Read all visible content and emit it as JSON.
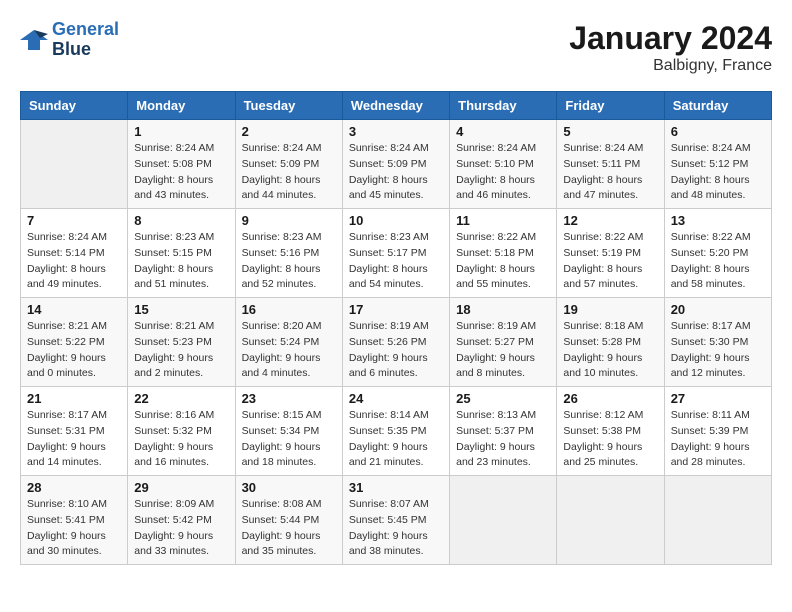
{
  "header": {
    "logo_line1": "General",
    "logo_line2": "Blue",
    "month": "January 2024",
    "location": "Balbigny, France"
  },
  "columns": [
    "Sunday",
    "Monday",
    "Tuesday",
    "Wednesday",
    "Thursday",
    "Friday",
    "Saturday"
  ],
  "weeks": [
    [
      {
        "day": "",
        "sunrise": "",
        "sunset": "",
        "daylight": ""
      },
      {
        "day": "1",
        "sunrise": "Sunrise: 8:24 AM",
        "sunset": "Sunset: 5:08 PM",
        "daylight": "Daylight: 8 hours and 43 minutes."
      },
      {
        "day": "2",
        "sunrise": "Sunrise: 8:24 AM",
        "sunset": "Sunset: 5:09 PM",
        "daylight": "Daylight: 8 hours and 44 minutes."
      },
      {
        "day": "3",
        "sunrise": "Sunrise: 8:24 AM",
        "sunset": "Sunset: 5:09 PM",
        "daylight": "Daylight: 8 hours and 45 minutes."
      },
      {
        "day": "4",
        "sunrise": "Sunrise: 8:24 AM",
        "sunset": "Sunset: 5:10 PM",
        "daylight": "Daylight: 8 hours and 46 minutes."
      },
      {
        "day": "5",
        "sunrise": "Sunrise: 8:24 AM",
        "sunset": "Sunset: 5:11 PM",
        "daylight": "Daylight: 8 hours and 47 minutes."
      },
      {
        "day": "6",
        "sunrise": "Sunrise: 8:24 AM",
        "sunset": "Sunset: 5:12 PM",
        "daylight": "Daylight: 8 hours and 48 minutes."
      }
    ],
    [
      {
        "day": "7",
        "sunrise": "Sunrise: 8:24 AM",
        "sunset": "Sunset: 5:14 PM",
        "daylight": "Daylight: 8 hours and 49 minutes."
      },
      {
        "day": "8",
        "sunrise": "Sunrise: 8:23 AM",
        "sunset": "Sunset: 5:15 PM",
        "daylight": "Daylight: 8 hours and 51 minutes."
      },
      {
        "day": "9",
        "sunrise": "Sunrise: 8:23 AM",
        "sunset": "Sunset: 5:16 PM",
        "daylight": "Daylight: 8 hours and 52 minutes."
      },
      {
        "day": "10",
        "sunrise": "Sunrise: 8:23 AM",
        "sunset": "Sunset: 5:17 PM",
        "daylight": "Daylight: 8 hours and 54 minutes."
      },
      {
        "day": "11",
        "sunrise": "Sunrise: 8:22 AM",
        "sunset": "Sunset: 5:18 PM",
        "daylight": "Daylight: 8 hours and 55 minutes."
      },
      {
        "day": "12",
        "sunrise": "Sunrise: 8:22 AM",
        "sunset": "Sunset: 5:19 PM",
        "daylight": "Daylight: 8 hours and 57 minutes."
      },
      {
        "day": "13",
        "sunrise": "Sunrise: 8:22 AM",
        "sunset": "Sunset: 5:20 PM",
        "daylight": "Daylight: 8 hours and 58 minutes."
      }
    ],
    [
      {
        "day": "14",
        "sunrise": "Sunrise: 8:21 AM",
        "sunset": "Sunset: 5:22 PM",
        "daylight": "Daylight: 9 hours and 0 minutes."
      },
      {
        "day": "15",
        "sunrise": "Sunrise: 8:21 AM",
        "sunset": "Sunset: 5:23 PM",
        "daylight": "Daylight: 9 hours and 2 minutes."
      },
      {
        "day": "16",
        "sunrise": "Sunrise: 8:20 AM",
        "sunset": "Sunset: 5:24 PM",
        "daylight": "Daylight: 9 hours and 4 minutes."
      },
      {
        "day": "17",
        "sunrise": "Sunrise: 8:19 AM",
        "sunset": "Sunset: 5:26 PM",
        "daylight": "Daylight: 9 hours and 6 minutes."
      },
      {
        "day": "18",
        "sunrise": "Sunrise: 8:19 AM",
        "sunset": "Sunset: 5:27 PM",
        "daylight": "Daylight: 9 hours and 8 minutes."
      },
      {
        "day": "19",
        "sunrise": "Sunrise: 8:18 AM",
        "sunset": "Sunset: 5:28 PM",
        "daylight": "Daylight: 9 hours and 10 minutes."
      },
      {
        "day": "20",
        "sunrise": "Sunrise: 8:17 AM",
        "sunset": "Sunset: 5:30 PM",
        "daylight": "Daylight: 9 hours and 12 minutes."
      }
    ],
    [
      {
        "day": "21",
        "sunrise": "Sunrise: 8:17 AM",
        "sunset": "Sunset: 5:31 PM",
        "daylight": "Daylight: 9 hours and 14 minutes."
      },
      {
        "day": "22",
        "sunrise": "Sunrise: 8:16 AM",
        "sunset": "Sunset: 5:32 PM",
        "daylight": "Daylight: 9 hours and 16 minutes."
      },
      {
        "day": "23",
        "sunrise": "Sunrise: 8:15 AM",
        "sunset": "Sunset: 5:34 PM",
        "daylight": "Daylight: 9 hours and 18 minutes."
      },
      {
        "day": "24",
        "sunrise": "Sunrise: 8:14 AM",
        "sunset": "Sunset: 5:35 PM",
        "daylight": "Daylight: 9 hours and 21 minutes."
      },
      {
        "day": "25",
        "sunrise": "Sunrise: 8:13 AM",
        "sunset": "Sunset: 5:37 PM",
        "daylight": "Daylight: 9 hours and 23 minutes."
      },
      {
        "day": "26",
        "sunrise": "Sunrise: 8:12 AM",
        "sunset": "Sunset: 5:38 PM",
        "daylight": "Daylight: 9 hours and 25 minutes."
      },
      {
        "day": "27",
        "sunrise": "Sunrise: 8:11 AM",
        "sunset": "Sunset: 5:39 PM",
        "daylight": "Daylight: 9 hours and 28 minutes."
      }
    ],
    [
      {
        "day": "28",
        "sunrise": "Sunrise: 8:10 AM",
        "sunset": "Sunset: 5:41 PM",
        "daylight": "Daylight: 9 hours and 30 minutes."
      },
      {
        "day": "29",
        "sunrise": "Sunrise: 8:09 AM",
        "sunset": "Sunset: 5:42 PM",
        "daylight": "Daylight: 9 hours and 33 minutes."
      },
      {
        "day": "30",
        "sunrise": "Sunrise: 8:08 AM",
        "sunset": "Sunset: 5:44 PM",
        "daylight": "Daylight: 9 hours and 35 minutes."
      },
      {
        "day": "31",
        "sunrise": "Sunrise: 8:07 AM",
        "sunset": "Sunset: 5:45 PM",
        "daylight": "Daylight: 9 hours and 38 minutes."
      },
      {
        "day": "",
        "sunrise": "",
        "sunset": "",
        "daylight": ""
      },
      {
        "day": "",
        "sunrise": "",
        "sunset": "",
        "daylight": ""
      },
      {
        "day": "",
        "sunrise": "",
        "sunset": "",
        "daylight": ""
      }
    ]
  ]
}
